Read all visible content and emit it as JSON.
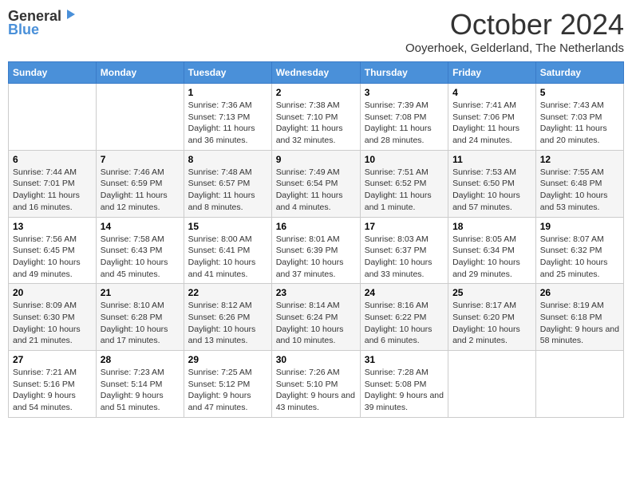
{
  "header": {
    "logo_general": "General",
    "logo_blue": "Blue",
    "title": "October 2024",
    "location": "Ooyerhoek, Gelderland, The Netherlands"
  },
  "days_of_week": [
    "Sunday",
    "Monday",
    "Tuesday",
    "Wednesday",
    "Thursday",
    "Friday",
    "Saturday"
  ],
  "weeks": [
    [
      {
        "day": "",
        "info": ""
      },
      {
        "day": "",
        "info": ""
      },
      {
        "day": "1",
        "info": "Sunrise: 7:36 AM\nSunset: 7:13 PM\nDaylight: 11 hours and 36 minutes."
      },
      {
        "day": "2",
        "info": "Sunrise: 7:38 AM\nSunset: 7:10 PM\nDaylight: 11 hours and 32 minutes."
      },
      {
        "day": "3",
        "info": "Sunrise: 7:39 AM\nSunset: 7:08 PM\nDaylight: 11 hours and 28 minutes."
      },
      {
        "day": "4",
        "info": "Sunrise: 7:41 AM\nSunset: 7:06 PM\nDaylight: 11 hours and 24 minutes."
      },
      {
        "day": "5",
        "info": "Sunrise: 7:43 AM\nSunset: 7:03 PM\nDaylight: 11 hours and 20 minutes."
      }
    ],
    [
      {
        "day": "6",
        "info": "Sunrise: 7:44 AM\nSunset: 7:01 PM\nDaylight: 11 hours and 16 minutes."
      },
      {
        "day": "7",
        "info": "Sunrise: 7:46 AM\nSunset: 6:59 PM\nDaylight: 11 hours and 12 minutes."
      },
      {
        "day": "8",
        "info": "Sunrise: 7:48 AM\nSunset: 6:57 PM\nDaylight: 11 hours and 8 minutes."
      },
      {
        "day": "9",
        "info": "Sunrise: 7:49 AM\nSunset: 6:54 PM\nDaylight: 11 hours and 4 minutes."
      },
      {
        "day": "10",
        "info": "Sunrise: 7:51 AM\nSunset: 6:52 PM\nDaylight: 11 hours and 1 minute."
      },
      {
        "day": "11",
        "info": "Sunrise: 7:53 AM\nSunset: 6:50 PM\nDaylight: 10 hours and 57 minutes."
      },
      {
        "day": "12",
        "info": "Sunrise: 7:55 AM\nSunset: 6:48 PM\nDaylight: 10 hours and 53 minutes."
      }
    ],
    [
      {
        "day": "13",
        "info": "Sunrise: 7:56 AM\nSunset: 6:45 PM\nDaylight: 10 hours and 49 minutes."
      },
      {
        "day": "14",
        "info": "Sunrise: 7:58 AM\nSunset: 6:43 PM\nDaylight: 10 hours and 45 minutes."
      },
      {
        "day": "15",
        "info": "Sunrise: 8:00 AM\nSunset: 6:41 PM\nDaylight: 10 hours and 41 minutes."
      },
      {
        "day": "16",
        "info": "Sunrise: 8:01 AM\nSunset: 6:39 PM\nDaylight: 10 hours and 37 minutes."
      },
      {
        "day": "17",
        "info": "Sunrise: 8:03 AM\nSunset: 6:37 PM\nDaylight: 10 hours and 33 minutes."
      },
      {
        "day": "18",
        "info": "Sunrise: 8:05 AM\nSunset: 6:34 PM\nDaylight: 10 hours and 29 minutes."
      },
      {
        "day": "19",
        "info": "Sunrise: 8:07 AM\nSunset: 6:32 PM\nDaylight: 10 hours and 25 minutes."
      }
    ],
    [
      {
        "day": "20",
        "info": "Sunrise: 8:09 AM\nSunset: 6:30 PM\nDaylight: 10 hours and 21 minutes."
      },
      {
        "day": "21",
        "info": "Sunrise: 8:10 AM\nSunset: 6:28 PM\nDaylight: 10 hours and 17 minutes."
      },
      {
        "day": "22",
        "info": "Sunrise: 8:12 AM\nSunset: 6:26 PM\nDaylight: 10 hours and 13 minutes."
      },
      {
        "day": "23",
        "info": "Sunrise: 8:14 AM\nSunset: 6:24 PM\nDaylight: 10 hours and 10 minutes."
      },
      {
        "day": "24",
        "info": "Sunrise: 8:16 AM\nSunset: 6:22 PM\nDaylight: 10 hours and 6 minutes."
      },
      {
        "day": "25",
        "info": "Sunrise: 8:17 AM\nSunset: 6:20 PM\nDaylight: 10 hours and 2 minutes."
      },
      {
        "day": "26",
        "info": "Sunrise: 8:19 AM\nSunset: 6:18 PM\nDaylight: 9 hours and 58 minutes."
      }
    ],
    [
      {
        "day": "27",
        "info": "Sunrise: 7:21 AM\nSunset: 5:16 PM\nDaylight: 9 hours and 54 minutes."
      },
      {
        "day": "28",
        "info": "Sunrise: 7:23 AM\nSunset: 5:14 PM\nDaylight: 9 hours and 51 minutes."
      },
      {
        "day": "29",
        "info": "Sunrise: 7:25 AM\nSunset: 5:12 PM\nDaylight: 9 hours and 47 minutes."
      },
      {
        "day": "30",
        "info": "Sunrise: 7:26 AM\nSunset: 5:10 PM\nDaylight: 9 hours and 43 minutes."
      },
      {
        "day": "31",
        "info": "Sunrise: 7:28 AM\nSunset: 5:08 PM\nDaylight: 9 hours and 39 minutes."
      },
      {
        "day": "",
        "info": ""
      },
      {
        "day": "",
        "info": ""
      }
    ]
  ]
}
